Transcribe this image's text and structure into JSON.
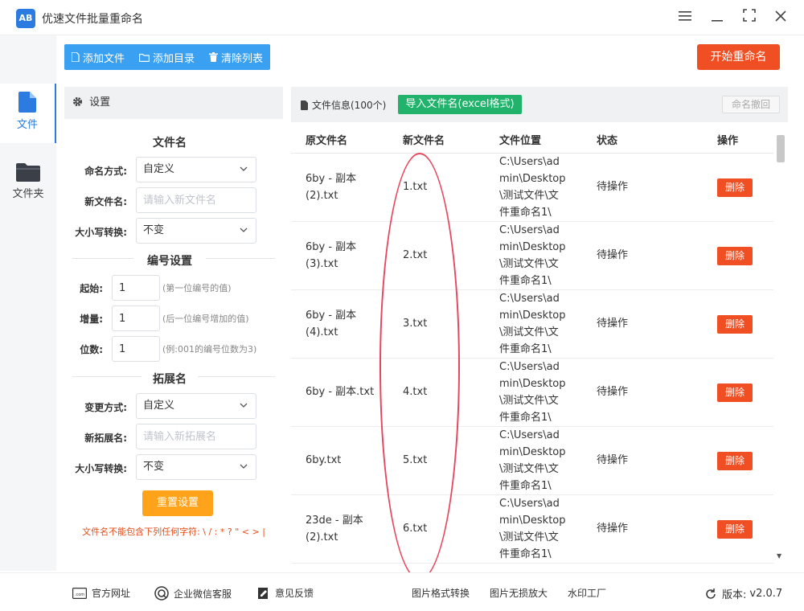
{
  "app": {
    "logo_text": "AB",
    "title": "优速文件批量重命名"
  },
  "nav": [
    {
      "label": "文件",
      "icon": "file-icon"
    },
    {
      "label": "文件夹",
      "icon": "folder-icon"
    }
  ],
  "toolbar": {
    "add_file": "添加文件",
    "add_dir": "添加目录",
    "clear_list": "清除列表",
    "start": "开始重命名"
  },
  "settings": {
    "header": "设置",
    "filename_section": "文件名",
    "naming_mode_label": "命名方式:",
    "naming_mode_value": "自定义",
    "new_name_label": "新文件名:",
    "new_name_placeholder": "请输入新文件名",
    "case_label": "大小写转换:",
    "case_value": "不变",
    "numbering_section": "编号设置",
    "start_label": "起始:",
    "start_value": "1",
    "start_hint": "(第一位编号的值)",
    "step_label": "增量:",
    "step_value": "1",
    "step_hint": "(后一位编号增加的值)",
    "digits_label": "位数:",
    "digits_value": "1",
    "digits_hint": "(例:001的编号位数为3)",
    "ext_section": "拓展名",
    "ext_mode_label": "变更方式:",
    "ext_mode_value": "自定义",
    "new_ext_label": "新拓展名:",
    "new_ext_placeholder": "请输入新拓展名",
    "ext_case_label": "大小写转换:",
    "ext_case_value": "不变",
    "reset": "重置设置",
    "warning": "文件名不能包含下列任何字符: \\ / : * ? \" < > |"
  },
  "file_panel": {
    "title": "文件信息(100个)",
    "import": "导入文件名(excel格式)",
    "undo": "命名撤回",
    "columns": [
      "原文件名",
      "新文件名",
      "文件位置",
      "状态",
      "操作"
    ],
    "rows": [
      {
        "orig": [
          "6by - 副本",
          "(2).txt"
        ],
        "new": "1.txt",
        "path": [
          "C:\\Users\\ad",
          "min\\Desktop",
          "\\测试文件\\文",
          "件重命名1\\"
        ],
        "status": "待操作",
        "action": "删除"
      },
      {
        "orig": [
          "6by - 副本",
          "(3).txt"
        ],
        "new": "2.txt",
        "path": [
          "C:\\Users\\ad",
          "min\\Desktop",
          "\\测试文件\\文",
          "件重命名1\\"
        ],
        "status": "待操作",
        "action": "删除"
      },
      {
        "orig": [
          "6by - 副本",
          "(4).txt"
        ],
        "new": "3.txt",
        "path": [
          "C:\\Users\\ad",
          "min\\Desktop",
          "\\测试文件\\文",
          "件重命名1\\"
        ],
        "status": "待操作",
        "action": "删除"
      },
      {
        "orig": [
          "6by - 副本.txt"
        ],
        "new": "4.txt",
        "path": [
          "C:\\Users\\ad",
          "min\\Desktop",
          "\\测试文件\\文",
          "件重命名1\\"
        ],
        "status": "待操作",
        "action": "删除"
      },
      {
        "orig": [
          "6by.txt"
        ],
        "new": "5.txt",
        "path": [
          "C:\\Users\\ad",
          "min\\Desktop",
          "\\测试文件\\文",
          "件重命名1\\"
        ],
        "status": "待操作",
        "action": "删除"
      },
      {
        "orig": [
          "23de - 副本",
          "(2).txt"
        ],
        "new": "6.txt",
        "path": [
          "C:\\Users\\ad",
          "min\\Desktop",
          "\\测试文件\\文",
          "件重命名1\\"
        ],
        "status": "待操作",
        "action": "删除"
      }
    ]
  },
  "footer": {
    "website": "官方网址",
    "wechat": "企业微信客服",
    "feedback": "意见反馈",
    "img_convert": "图片格式转换",
    "img_enlarge": "图片无损放大",
    "watermark": "水印工厂",
    "version_label": "版本:",
    "version": "v2.0.7"
  },
  "colors": {
    "accent": "#2b7be0",
    "toolbar": "#3aa0f2",
    "danger": "#f04e23",
    "success": "#21b36b",
    "warning": "#ffa31a",
    "annotation": "#e8455e"
  }
}
